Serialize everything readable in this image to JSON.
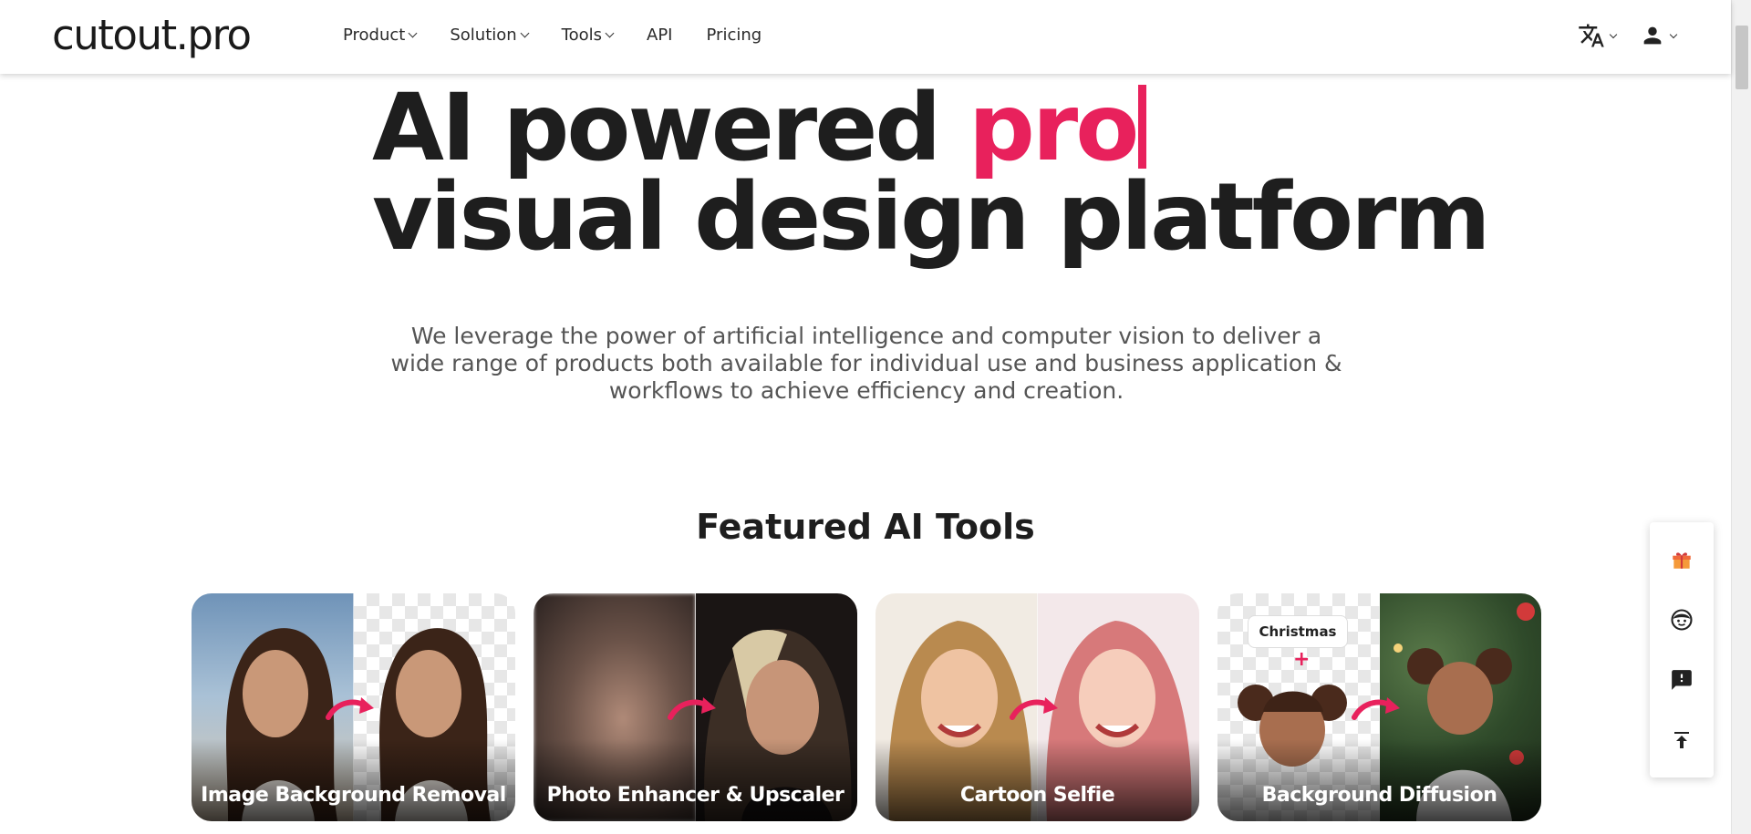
{
  "header": {
    "logo": "cutout.pro",
    "nav": [
      {
        "label": "Product",
        "dropdown": true
      },
      {
        "label": "Solution",
        "dropdown": true
      },
      {
        "label": "Tools",
        "dropdown": true
      },
      {
        "label": "API",
        "dropdown": false
      },
      {
        "label": "Pricing",
        "dropdown": false
      }
    ],
    "right_icons": [
      "translate-icon",
      "user-icon"
    ]
  },
  "hero": {
    "title_line1": "AI powered ",
    "title_accent": "pro",
    "title_line2": "visual design platform",
    "subtitle": "We leverage the power of artificial intelligence and computer vision to deliver a wide range of products both available for individual use and business application & workflows to achieve efficiency and creation."
  },
  "featured": {
    "title": "Featured AI Tools",
    "cards": [
      {
        "label": "Image Background Removal"
      },
      {
        "label": "Photo Enhancer & Upscaler"
      },
      {
        "label": "Cartoon Selfie"
      },
      {
        "label": "Background Diffusion",
        "tag": "Christmas",
        "plus": "+"
      }
    ]
  },
  "side_panel": [
    "gift-icon",
    "support-face-icon",
    "feedback-icon",
    "back-to-top-icon"
  ],
  "colors": {
    "accent": "#e8215c",
    "text": "#1e1e1e",
    "muted": "#555555"
  }
}
